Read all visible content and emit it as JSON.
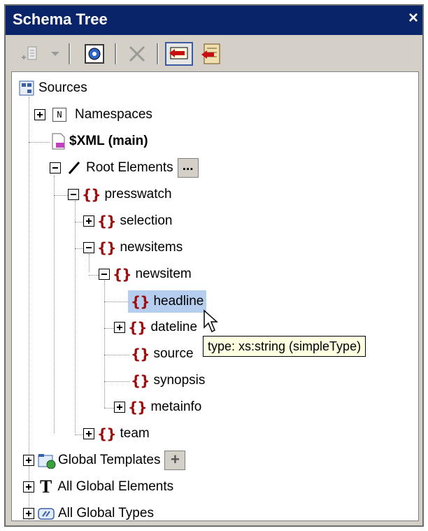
{
  "panel": {
    "title": "Schema Tree",
    "close_glyph": "×"
  },
  "toolbar": {
    "buttons": [
      {
        "icon": "add-item-icon"
      },
      {
        "icon": "dropdown-arrow-icon"
      },
      {
        "icon": "globe-settings-icon"
      },
      {
        "icon": "delete-icon"
      },
      {
        "icon": "show-tooltips-icon",
        "active": true
      },
      {
        "icon": "sync-tree-icon"
      }
    ]
  },
  "tree": {
    "sources_label": "Sources",
    "namespaces_label": "Namespaces",
    "namespaces_icon_glyph": "N",
    "xml_main_label": "$XML (main)",
    "root_elements_label": "Root Elements",
    "root_elements_button": "...",
    "presswatch_label": "presswatch",
    "selection_label": "selection",
    "newsitems_label": "newsitems",
    "newsitem_label": "newsitem",
    "headline_label": "headline",
    "dateline_label": "dateline",
    "source_label": "source",
    "synopsis_label": "synopsis",
    "metainfo_label": "metainfo",
    "team_label": "team",
    "global_templates_label": "Global Templates",
    "global_templates_button": "+",
    "all_global_elements_label": "All Global Elements",
    "all_global_elements_glyph": "T",
    "all_global_types_label": "All Global Types",
    "element_glyph": "{}"
  },
  "tooltip": {
    "text": "type: xs:string (simpleType)"
  },
  "colors": {
    "title_bg": "#0a246a",
    "selection_bg": "#b5cdee",
    "element_icon": "#9b0f0f",
    "tooltip_bg": "#ffffe1"
  }
}
